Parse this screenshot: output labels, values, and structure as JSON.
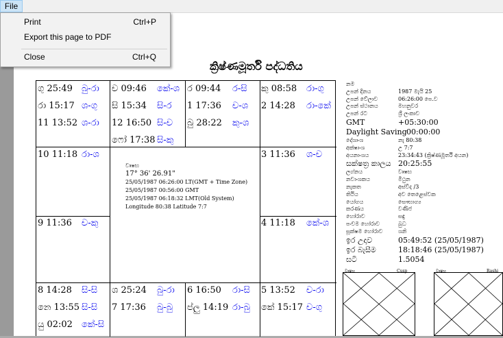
{
  "menubar": {
    "file_label": "File"
  },
  "file_menu": {
    "items": [
      {
        "label": "Print",
        "shortcut": "Ctrl+P"
      },
      {
        "label": "Export this page to PDF",
        "shortcut": ""
      },
      {
        "label": "Close",
        "shortcut": "Ctrl+Q"
      }
    ]
  },
  "page": {
    "title": "ක්‍රිෂ්ණමූර්ති පද්ධතිය",
    "chart": {
      "cells": [
        {
          "lines": [
            {
              "planet": "ගු",
              "deg": "25:49",
              "lord": "බු-රා"
            },
            {
              "planet": "රා",
              "deg": "15:17",
              "lord": "ශ-ගු"
            },
            {
              "planet": "11",
              "deg": "13:52",
              "lord": "ශ-රා"
            }
          ]
        },
        {
          "lines": [
            {
              "planet": "ච",
              "deg": "09:46",
              "lord": "කේ-ශ"
            },
            {
              "planet": "සි",
              "deg": "15:34",
              "lord": "සි-ර"
            },
            {
              "planet": "12",
              "deg": "16:50",
              "lord": "සි-ච"
            },
            {
              "planet": "ෆෝ",
              "deg": "17:38",
              "lord": "සි-කු"
            }
          ]
        },
        {
          "lines": [
            {
              "planet": "ර",
              "deg": "09:44",
              "lord": "ර-සි"
            },
            {
              "planet": "1",
              "deg": "17:36",
              "lord": "ච-ශ"
            },
            {
              "planet": "බු",
              "deg": "28:22",
              "lord": "කු-ශ"
            }
          ]
        },
        {
          "lines": [
            {
              "planet": "කු",
              "deg": "08:58",
              "lord": "රා-ගු"
            },
            {
              "planet": "2",
              "deg": "14:28",
              "lord": "රා-කේ"
            }
          ]
        },
        {
          "lines": [
            {
              "planet": "10",
              "deg": "11:18",
              "lord": "රා-ශ"
            }
          ]
        },
        {
          "lines": [
            {
              "planet": "3",
              "deg": "11:36",
              "lord": "ශ-ච"
            }
          ]
        },
        {
          "lines": [
            {
              "planet": "9",
              "deg": "11:36",
              "lord": "ච-කු"
            }
          ]
        },
        {
          "lines": [
            {
              "planet": "4",
              "deg": "11:18",
              "lord": "කේ-ශ"
            }
          ]
        },
        {
          "lines": [
            {
              "planet": "8",
              "deg": "14:28",
              "lord": "සි-සි"
            },
            {
              "planet": "නෙ",
              "deg": "13:55",
              "lord": "සි-සි"
            },
            {
              "planet": "යු",
              "deg": "02:02",
              "lord": "කේ-සි"
            }
          ]
        },
        {
          "lines": [
            {
              "planet": "ශ",
              "deg": "25:24",
              "lord": "බු-රා"
            },
            {
              "planet": "7",
              "deg": "17:36",
              "lord": "බු-බු"
            }
          ]
        },
        {
          "lines": [
            {
              "planet": "6",
              "deg": "16:50",
              "lord": "රා-සි"
            },
            {
              "planet": "ප්ලු",
              "deg": "14:19",
              "lord": "රා-බු"
            }
          ]
        },
        {
          "lines": [
            {
              "planet": "5",
              "deg": "13:52",
              "lord": "ච-රා"
            },
            {
              "planet": "කේ",
              "deg": "15:17",
              "lord": "ච-ගු"
            }
          ]
        }
      ],
      "center": {
        "lagna": "වෘෂභ",
        "lagna_deg": "17° 36' 26.91\"",
        "lt": "25/05/1987 06:26:00 LT(GMT + Time Zone)",
        "gmt": "25/05/1987 00:56:00 GMT",
        "lmt": "25/05/1987 06:18:32 LMT(Old System)",
        "coords": "Longitude 80:38  Latitude 7:7"
      }
    },
    "details": [
      {
        "k": "නම",
        "v": "",
        "size": "s"
      },
      {
        "k": "උපන් දිනය",
        "v": "1987 මැයි 25",
        "size": "s"
      },
      {
        "k": "උපන් වේලාව",
        "v": "06:26:00 පෙ.ව",
        "size": "s"
      },
      {
        "k": "උපන් ස්ථානය",
        "v": "මහනුවර",
        "size": "s"
      },
      {
        "k": "උපන් රට",
        "v": "ශ්‍රී ලංකාව",
        "size": "s"
      },
      {
        "k": "GMT",
        "v": "+05:30:00",
        "size": "m"
      },
      {
        "k": "Daylight Saving",
        "v": "00:00:00",
        "size": "m",
        "vwide": true
      },
      {
        "k": "දේශාංශ",
        "v": "නැ 80:38",
        "size": "s"
      },
      {
        "k": "අක්ෂාංශ",
        "v": "උ 7:7",
        "size": "s"
      },
      {
        "k": "අයනාංශය",
        "v": "23:34:43 (ක්‍රිෂ්ණමූර්ති අයන)",
        "size": "s"
      },
      {
        "k": "සක්ෂත්‍ර කාලය",
        "v": "20:25:55",
        "size": "m"
      },
      {
        "k": "ලග්නය",
        "v": "වෘෂභ",
        "size": "s"
      },
      {
        "k": "නවාංශකය",
        "v": "මිථුන",
        "size": "s"
      },
      {
        "k": "නැකත",
        "v": "අස්විද  /3",
        "size": "s"
      },
      {
        "k": "තිථිය",
        "v": "අව තෙළෙස්වක",
        "size": "s"
      },
      {
        "k": "යෝගය",
        "v": "සෞභාග්‍ය",
        "size": "s"
      },
      {
        "k": "කරණය",
        "v": "වණිජ",
        "size": "s"
      },
      {
        "k": "හෝරාව",
        "v": "සඳු",
        "size": "s"
      },
      {
        "k": "පංචම හෝරාව",
        "v": "බුධ",
        "size": "s"
      },
      {
        "k": "සූක්ෂම හෝරාව",
        "v": "ශනි",
        "size": "s"
      },
      {
        "k": "ඉර උදාව",
        "v": "05:49:52 (25/05/1987)",
        "size": "m"
      },
      {
        "k": "ඉර බැසීම",
        "v": "18:18:46 (25/05/1987)",
        "size": "m"
      },
      {
        "k": "ඝටි",
        "v": "1.5054",
        "size": "m"
      }
    ],
    "mini_charts": [
      {
        "label_left": "වෘෂභ",
        "label_right": "Cusp"
      },
      {
        "label_left": "වෘෂභ",
        "label_right": "Rashi"
      }
    ]
  }
}
